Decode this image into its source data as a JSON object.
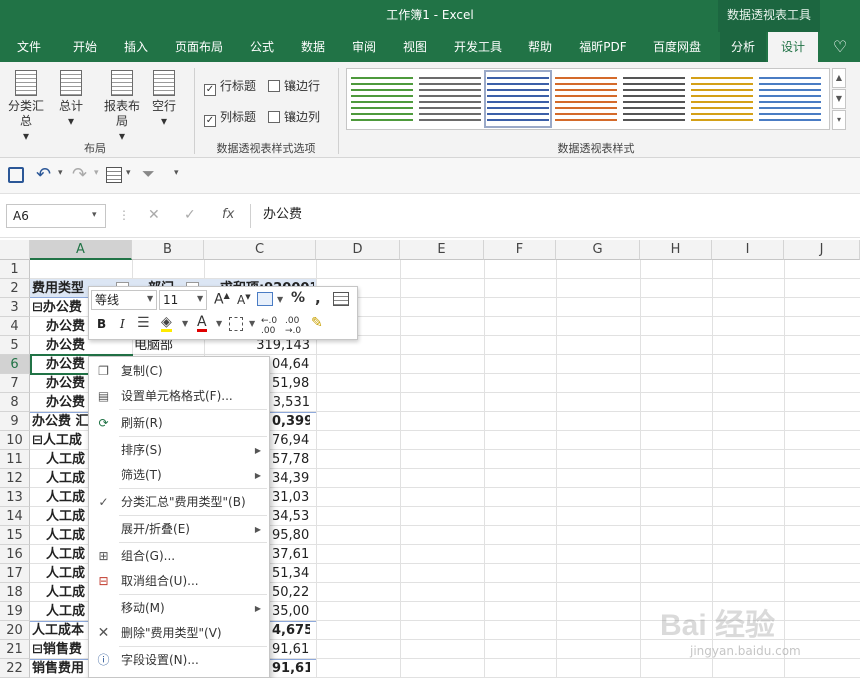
{
  "title_bar": {
    "title": "工作簿1  -  Excel",
    "tool_title": "数据透视表工具"
  },
  "tabs": [
    "文件",
    "开始",
    "插入",
    "页面布局",
    "公式",
    "数据",
    "审阅",
    "视图",
    "开发工具",
    "帮助",
    "福昕PDF",
    "百度网盘",
    "分析",
    "设计"
  ],
  "active_tab": "设计",
  "ribbon": {
    "layout": {
      "buttons": [
        "分类汇总",
        "总计",
        "报表布局",
        "空行"
      ],
      "group": "布局"
    },
    "style_options": {
      "options": [
        {
          "label": "行标题",
          "checked": true
        },
        {
          "label": "镶边行",
          "checked": false
        },
        {
          "label": "列标题",
          "checked": true
        },
        {
          "label": "镶边列",
          "checked": false
        }
      ],
      "group": "数据透视表样式选项"
    },
    "styles": {
      "group": "数据透视表样式",
      "swatches": [
        "#4e9a3c",
        "#6b6b6b",
        "#3b5fa8",
        "#d46a2a",
        "#555555",
        "#d4a017",
        "#4a7cc4"
      ]
    }
  },
  "formula_bar": {
    "name_box": "A6",
    "formula": "办公费"
  },
  "columns": [
    "A",
    "B",
    "C",
    "D",
    "E",
    "F",
    "G",
    "H",
    "I",
    "J"
  ],
  "rows": [
    "1",
    "2",
    "3",
    "4",
    "5",
    "6",
    "7",
    "8",
    "9",
    "10",
    "11",
    "12",
    "13",
    "14",
    "15",
    "16",
    "17",
    "18",
    "19",
    "20",
    "21",
    "22"
  ],
  "cells": {
    "a2": "费用类型",
    "b2": "部门",
    "c2": "求和项:920001",
    "a3": "⊟办公费",
    "a4": "办公费",
    "a5": "办公费",
    "b5": "电脑部",
    "c5": "319,143",
    "a6": "办公费",
    "c6": "04,643",
    "a7": "办公费",
    "c7": "51,981",
    "a8": "办公费",
    "c8": "3,531",
    "a9": "办公费 汇",
    "c9": "0,399",
    "a10": "⊟人工成",
    "c10": "76,942",
    "a11": "人工成",
    "c11": "57,787",
    "a12": "人工成",
    "c12": "34,399",
    "a13": "人工成",
    "c13": "31,030",
    "a14": "人工成",
    "c14": "34,531",
    "a15": "人工成",
    "c15": "95,805",
    "a16": "人工成",
    "c16": "37,611",
    "a17": "人工成",
    "c17": "51,345",
    "a18": "人工成",
    "c18": "50,220",
    "a19": "人工成",
    "c19": "35,006",
    "a20": "人工成本",
    "c20": "4,675",
    "a21": "⊟销售费",
    "c21": "91,613",
    "a22": "销售费用",
    "c22": "91,613"
  },
  "mini_toolbar": {
    "font": "等线",
    "size": "11",
    "percent": "%",
    "comma": ","
  },
  "context_menu": [
    "复制(C)",
    "设置单元格格式(F)...",
    "刷新(R)",
    "排序(S)",
    "筛选(T)",
    "分类汇总\"费用类型\"(B)",
    "展开/折叠(E)",
    "组合(G)...",
    "取消组合(U)...",
    "移动(M)",
    "删除\"费用类型\"(V)",
    "字段设置(N)..."
  ],
  "watermark": {
    "brand": "Bai 经验",
    "url": "jingyan.baidu.com"
  }
}
